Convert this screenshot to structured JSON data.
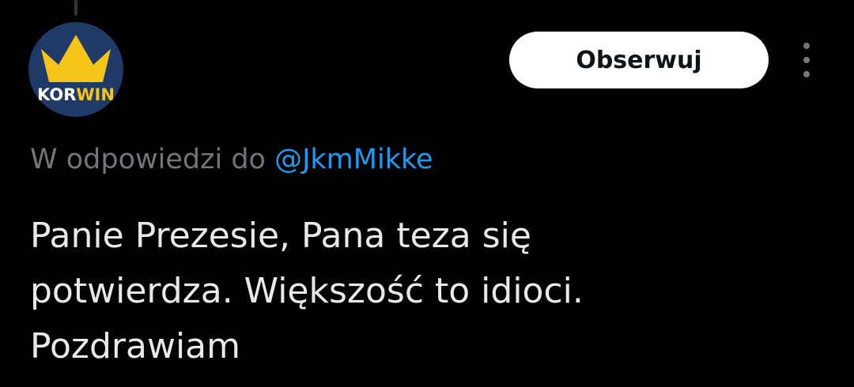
{
  "avatar": {
    "text_main": "KOR",
    "text_accent": "WIN",
    "icon": "crown-icon",
    "colors": {
      "background": "#1f3a66",
      "crown": "#f6c417"
    }
  },
  "header": {
    "follow_label": "Obserwuj",
    "more_icon": "more-vertical-icon"
  },
  "reply": {
    "prefix": "W odpowiedzi do",
    "handle": "@JkmMikke"
  },
  "tweet": {
    "lines": [
      "Panie Prezesie, Pana teza się",
      "potwierdza. Większość to idioci.",
      "Pozdrawiam"
    ]
  },
  "colors": {
    "background": "#000000",
    "text": "#e7e9ea",
    "muted": "#71767b",
    "link": "#1d9bf0"
  }
}
